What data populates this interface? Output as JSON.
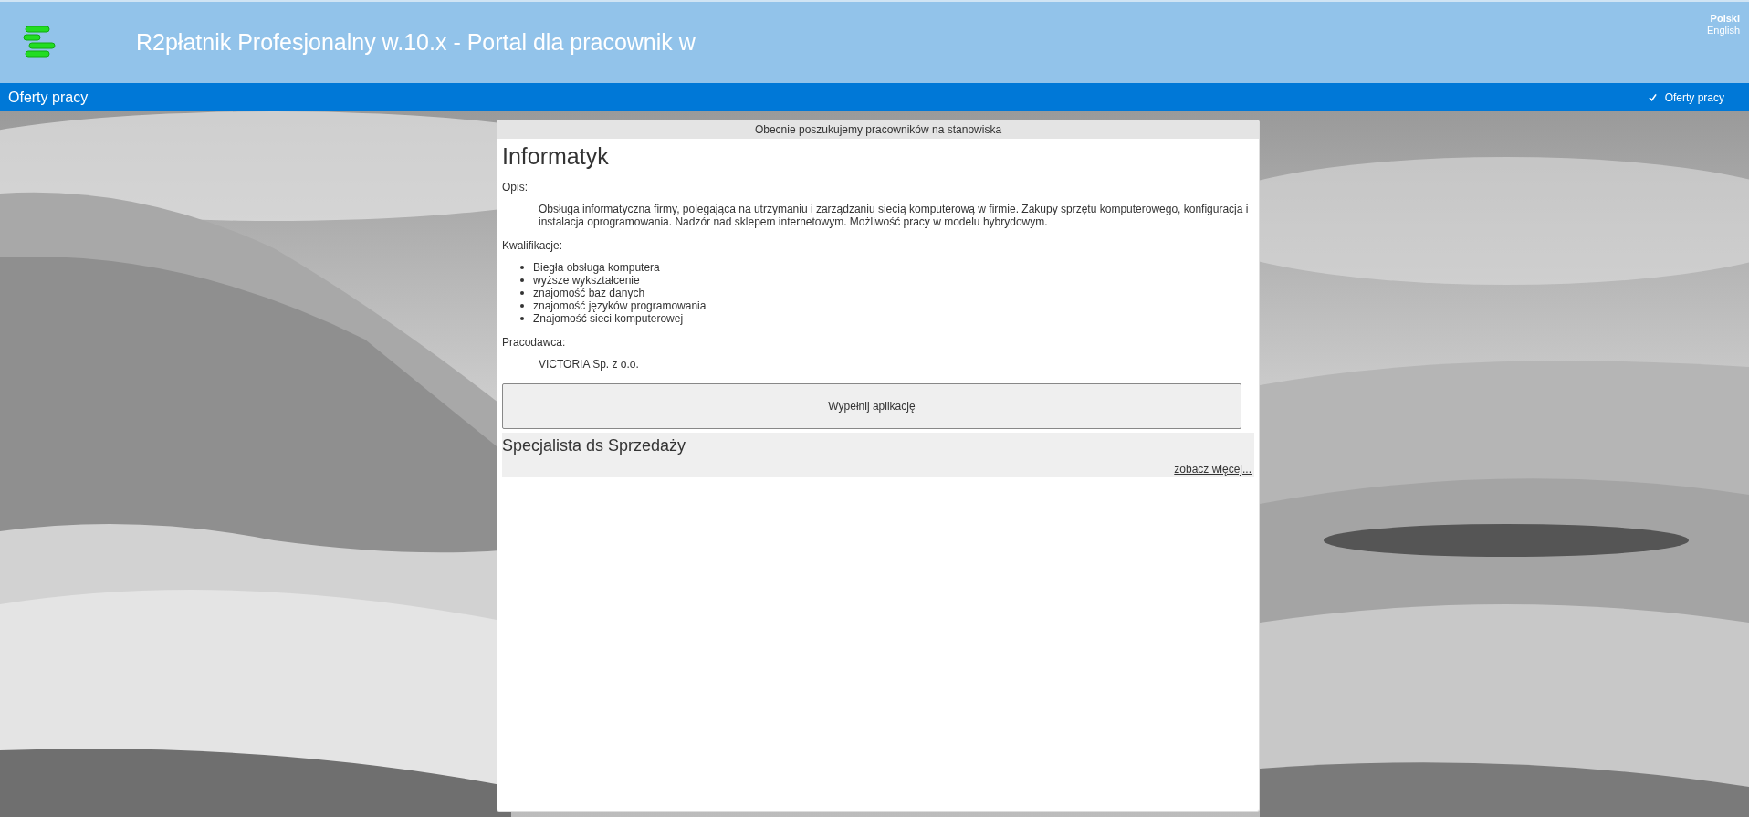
{
  "header": {
    "title": "R2płatnik Profesjonalny w.10.x - Portal dla pracownik w"
  },
  "languages": [
    {
      "label": "Polski",
      "selected": true
    },
    {
      "label": "English",
      "selected": false
    }
  ],
  "nav": {
    "title": "Oferty pracy",
    "menu": [
      {
        "label": "Oferty pracy",
        "checked": true
      }
    ]
  },
  "panel": {
    "title": "Obecnie poszukujemy pracowników na stanowiska",
    "offers": [
      {
        "kind": "expanded",
        "title": "Informatyk",
        "sections": [
          {
            "kind": "text",
            "label": "Opis:",
            "text": "Obsługa informatyczna firmy, polegająca na utrzymaniu i zarządzaniu siecią komputerową w firmie. Zakupy sprzętu komputerowego, konfiguracja i instalacja oprogramowania. Nadzór nad sklepem internetowym. Możliwość pracy w modelu hybrydowym."
          },
          {
            "kind": "list",
            "label": "Kwalifikacje:",
            "items": [
              "Biegła obsługa komputera",
              "wyższe wykształcenie",
              "znajomość baz danych",
              "znajomość języków programowania",
              "Znajomość sieci komputerowej"
            ]
          },
          {
            "kind": "text",
            "label": "Pracodawca:",
            "text": "VICTORIA Sp. z o.o."
          }
        ],
        "button": "Wypełnij aplikację"
      },
      {
        "kind": "collapsed",
        "title": "Specjalista ds Sprzedaży",
        "link": "zobacz więcej..."
      }
    ]
  }
}
